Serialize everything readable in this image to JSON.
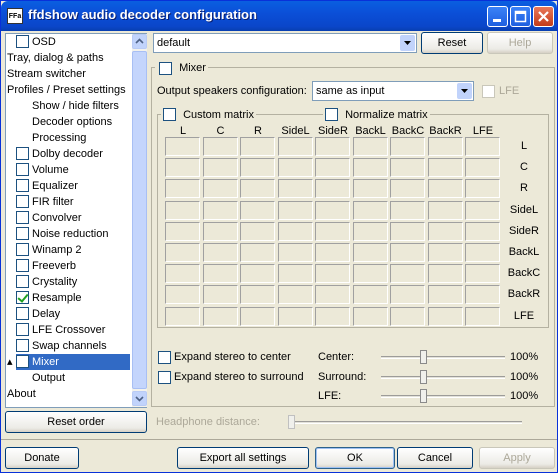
{
  "window": {
    "title": "ffdshow audio decoder configuration",
    "icon_text": "FFa"
  },
  "sidebar": {
    "items": [
      {
        "label": "OSD",
        "checkbox": true,
        "checked": false,
        "indent": 1
      },
      {
        "label": "Tray, dialog & paths",
        "checkbox": false,
        "indent": 0
      },
      {
        "label": "Stream switcher",
        "checkbox": false,
        "indent": 0
      },
      {
        "label": "Profiles / Preset settings",
        "checkbox": false,
        "indent": 0
      },
      {
        "label": "Show / hide filters",
        "checkbox": false,
        "indent": 2
      },
      {
        "label": "Decoder options",
        "checkbox": false,
        "indent": 2
      },
      {
        "label": "Processing",
        "checkbox": false,
        "indent": 2
      },
      {
        "label": "Dolby decoder",
        "checkbox": true,
        "checked": false,
        "indent": 1
      },
      {
        "label": "Volume",
        "checkbox": true,
        "checked": false,
        "indent": 1
      },
      {
        "label": "Equalizer",
        "checkbox": true,
        "checked": false,
        "indent": 1
      },
      {
        "label": "FIR filter",
        "checkbox": true,
        "checked": false,
        "indent": 1
      },
      {
        "label": "Convolver",
        "checkbox": true,
        "checked": false,
        "indent": 1
      },
      {
        "label": "Noise reduction",
        "checkbox": true,
        "checked": false,
        "indent": 1
      },
      {
        "label": "Winamp 2",
        "checkbox": true,
        "checked": false,
        "indent": 1
      },
      {
        "label": "Freeverb",
        "checkbox": true,
        "checked": false,
        "indent": 1
      },
      {
        "label": "Crystality",
        "checkbox": true,
        "checked": false,
        "indent": 1
      },
      {
        "label": "Resample",
        "checkbox": true,
        "checked": true,
        "indent": 1
      },
      {
        "label": "Delay",
        "checkbox": true,
        "checked": false,
        "indent": 1
      },
      {
        "label": "LFE Crossover",
        "checkbox": true,
        "checked": false,
        "indent": 1
      },
      {
        "label": "Swap channels",
        "checkbox": true,
        "checked": false,
        "indent": 1
      },
      {
        "label": "Mixer",
        "checkbox": true,
        "checked": false,
        "indent": 1,
        "selected": true
      },
      {
        "label": "Output",
        "checkbox": false,
        "indent": 2
      },
      {
        "label": "About",
        "checkbox": false,
        "indent": 0
      }
    ]
  },
  "preset": {
    "value": "default",
    "reset_label": "Reset",
    "help_label": "Help"
  },
  "mixer": {
    "enable_label": "Mixer",
    "output_config_label": "Output speakers configuration:",
    "output_config_value": "same as input",
    "lfe_label": "LFE",
    "custom_matrix_label": "Custom matrix",
    "normalize_matrix_label": "Normalize matrix",
    "columns": [
      "L",
      "C",
      "R",
      "SideL",
      "SideR",
      "BackL",
      "BackC",
      "BackR",
      "LFE"
    ],
    "rows": [
      "L",
      "C",
      "R",
      "SideL",
      "SideR",
      "BackL",
      "BackC",
      "BackR",
      "LFE"
    ],
    "expand_center_label": "Expand stereo to center",
    "expand_surround_label": "Expand stereo to surround",
    "center_label": "Center:",
    "surround_label": "Surround:",
    "lfe_level_label": "LFE:",
    "center_value": "100%",
    "surround_value": "100%",
    "lfe_value": "100%",
    "headphone_label": "Headphone distance:"
  },
  "reset_order_label": "Reset order",
  "footer": {
    "donate_label": "Donate",
    "export_label": "Export all settings",
    "ok_label": "OK",
    "cancel_label": "Cancel",
    "apply_label": "Apply"
  }
}
